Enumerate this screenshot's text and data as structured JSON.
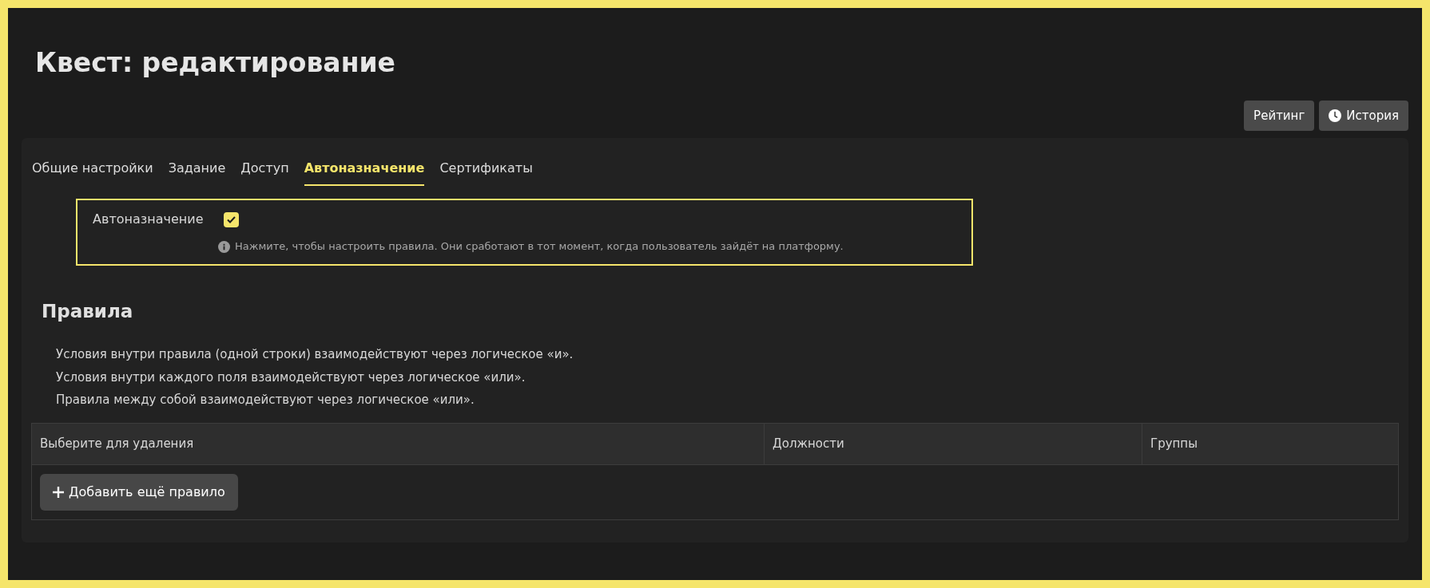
{
  "page": {
    "title": "Квест: редактирование"
  },
  "header_buttons": [
    {
      "label": "Рейтинг",
      "kind": "plain"
    },
    {
      "label": "История",
      "kind": "clock"
    }
  ],
  "tabs": [
    {
      "label": "Общие настройки",
      "selected": false
    },
    {
      "label": "Задание",
      "selected": false
    },
    {
      "label": "Доступ",
      "selected": false
    },
    {
      "label": "Автоназначение",
      "selected": true
    },
    {
      "label": "Сертификаты",
      "selected": false
    }
  ],
  "autoassign": {
    "label": "Автоназначение",
    "checked": true,
    "hint": "Нажмите, чтобы настроить правила. Они сработают в тот момент, когда пользователь зайдёт на платформу."
  },
  "rules": {
    "heading": "Правила",
    "notes": [
      "Условия внутри правила (одной строки) взаимодействуют через логическое «и».",
      "Условия внутри каждого поля взаимодействуют через логическое «или».",
      "Правила между собой взаимодействуют через логическое «или»."
    ],
    "table": {
      "columns": [
        "Выберите для удаления",
        "Должности",
        "Группы"
      ],
      "add_button": "Добавить ещё правило"
    }
  }
}
